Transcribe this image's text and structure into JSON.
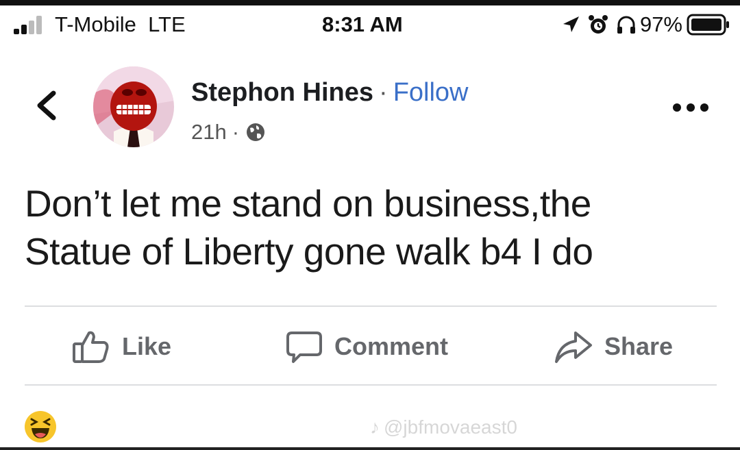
{
  "status_bar": {
    "carrier": "T-Mobile",
    "network": "LTE",
    "time": "8:31 AM",
    "battery_percent": "97%",
    "icons": [
      "signal-icon",
      "location-arrow-icon",
      "alarm-icon",
      "headphones-icon",
      "battery-icon"
    ]
  },
  "post": {
    "author": "Stephon Hines",
    "separator": "·",
    "follow_label": "Follow",
    "timestamp": "21h",
    "meta_separator": "·",
    "privacy_icon": "globe-icon",
    "text_line1": "Don’t let me stand on business,the",
    "text_line2": "Statue of Liberty gone walk b4 I do"
  },
  "actions": {
    "like_label": "Like",
    "comment_label": "Comment",
    "share_label": "Share"
  },
  "reactions": {
    "icon": "laughing-emoji-icon"
  },
  "watermark": {
    "text": "@jbfmovaeast0"
  },
  "colors": {
    "link_blue": "#3a6fc8",
    "action_gray": "#65676b",
    "divider": "#dcdde0"
  }
}
